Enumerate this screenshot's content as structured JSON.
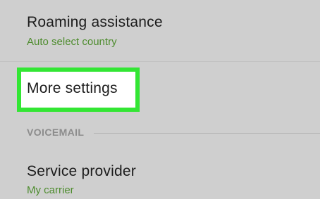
{
  "settings": {
    "roaming": {
      "title": "Roaming assistance",
      "subtitle": "Auto select country"
    },
    "more": {
      "title": "More settings",
      "highlight_color": "#33e634"
    },
    "voicemail_section": {
      "header": "VOICEMAIL"
    },
    "service_provider": {
      "title": "Service provider",
      "subtitle": "My carrier"
    }
  },
  "colors": {
    "background": "#cfcfcf",
    "subtitle_green": "#4e8c2e",
    "section_gray": "#8c8c8c"
  }
}
